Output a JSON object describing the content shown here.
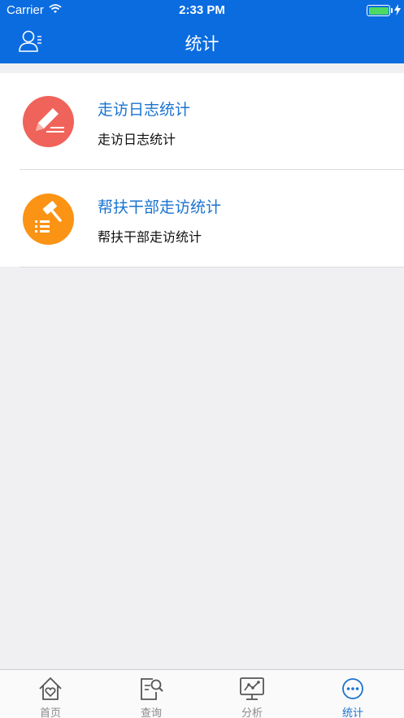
{
  "status_bar": {
    "carrier": "Carrier",
    "time": "2:33 PM"
  },
  "header": {
    "title": "统计",
    "user_icon": "user-list-icon"
  },
  "list": [
    {
      "title": "走访日志统计",
      "subtitle": "走访日志统计",
      "icon": "pencil-icon",
      "color": "#f0635a"
    },
    {
      "title": "帮扶干部走访统计",
      "subtitle": "帮扶干部走访统计",
      "icon": "gavel-icon",
      "color": "#fb9315"
    }
  ],
  "tabs": [
    {
      "label": "首页",
      "icon": "home-heart-icon",
      "active": false
    },
    {
      "label": "查询",
      "icon": "document-search-icon",
      "active": false
    },
    {
      "label": "分析",
      "icon": "monitor-chart-icon",
      "active": false
    },
    {
      "label": "统计",
      "icon": "more-dots-icon",
      "active": true
    }
  ],
  "colors": {
    "brand": "#0b6ce0",
    "link": "#1a73d0",
    "battery": "#4cd964"
  }
}
